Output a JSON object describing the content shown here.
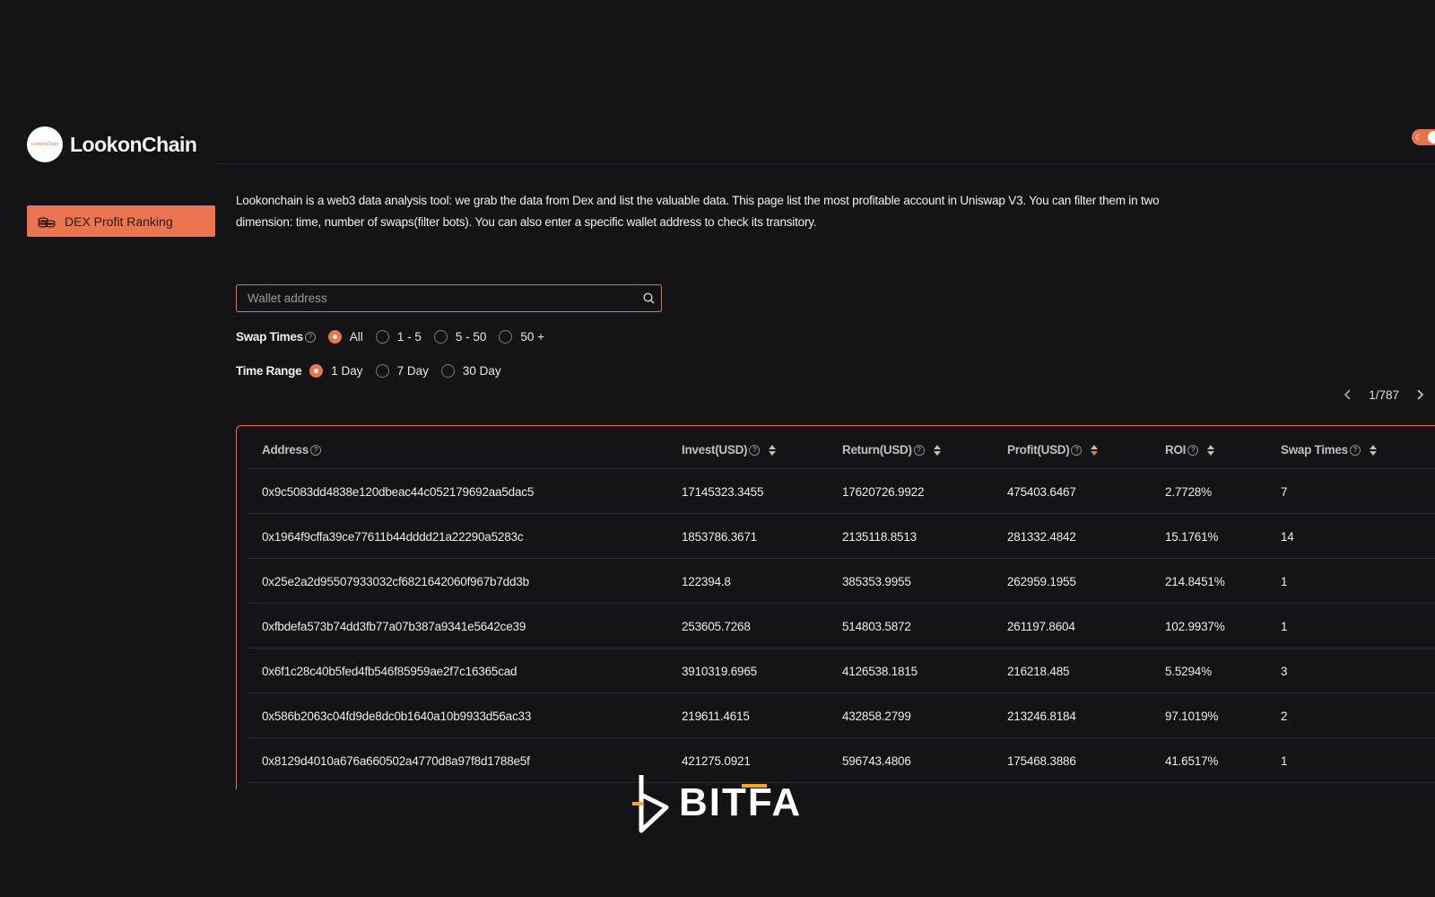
{
  "app": {
    "name": "LookonChain",
    "logo_mark": "LookonChain"
  },
  "nav": {
    "items": [
      {
        "label": "DEX Profit Ranking",
        "active": true
      }
    ]
  },
  "description": "Lookonchain is a web3 data analysis tool: we grab the data from Dex and list the valuable data. This page list the most profitable account in Uniswap V3. You can filter them in two dimension: time, number of swaps(filter bots). You can also enter a specific wallet address to check its transitory.",
  "search": {
    "placeholder": "Wallet address",
    "value": ""
  },
  "filters": {
    "swap_times": {
      "label": "Swap Times",
      "options": [
        "All",
        "1 - 5",
        "5 - 50",
        "50 +"
      ],
      "selected": "All"
    },
    "time_range": {
      "label": "Time Range",
      "options": [
        "1 Day",
        "7 Day",
        "30 Day"
      ],
      "selected": "1 Day"
    }
  },
  "pagination": {
    "text": "1/787"
  },
  "table": {
    "columns": [
      {
        "label": "Address",
        "help": true,
        "sortable": false
      },
      {
        "label": "Invest(USD)",
        "help": true,
        "sortable": true
      },
      {
        "label": "Return(USD)",
        "help": true,
        "sortable": true
      },
      {
        "label": "Profit(USD)",
        "help": true,
        "sortable": true,
        "active_sort": "desc"
      },
      {
        "label": "ROI",
        "help": true,
        "sortable": true
      },
      {
        "label": "Swap Times",
        "help": true,
        "sortable": true
      }
    ],
    "rows": [
      [
        "0x9c5083dd4838e120dbeac44c052179692aa5dac5",
        "17145323.3455",
        "17620726.9922",
        "475403.6467",
        "2.7728%",
        "7"
      ],
      [
        "0x1964f9cffa39ce77611b44dddd21a22290a5283c",
        "1853786.3671",
        "2135118.8513",
        "281332.4842",
        "15.1761%",
        "14"
      ],
      [
        "0x25e2a2d95507933032cf6821642060f967b7dd3b",
        "122394.8",
        "385353.9955",
        "262959.1955",
        "214.8451%",
        "1"
      ],
      [
        "0xfbdefa573b74dd3fb77a07b387a9341e5642ce39",
        "253605.7268",
        "514803.5872",
        "261197.8604",
        "102.9937%",
        "1"
      ],
      [
        "0x6f1c28c40b5fed4fb546f85959ae2f7c16365cad",
        "3910319.6965",
        "4126538.1815",
        "216218.485",
        "5.5294%",
        "3"
      ],
      [
        "0x586b2063c04fd9de8dc0b1640a10b9933d56ac33",
        "219611.4615",
        "432858.2799",
        "213246.8184",
        "97.1019%",
        "2"
      ],
      [
        "0x8129d4010a676a660502a4770d8a97f8d1788e5f",
        "421275.0921",
        "596743.4806",
        "175468.3886",
        "41.6517%",
        "1"
      ]
    ]
  },
  "watermark": {
    "text": "BITFA"
  },
  "colors": {
    "accent": "#ec7551",
    "background": "#141417",
    "watermark_bar": "#f5a623"
  }
}
